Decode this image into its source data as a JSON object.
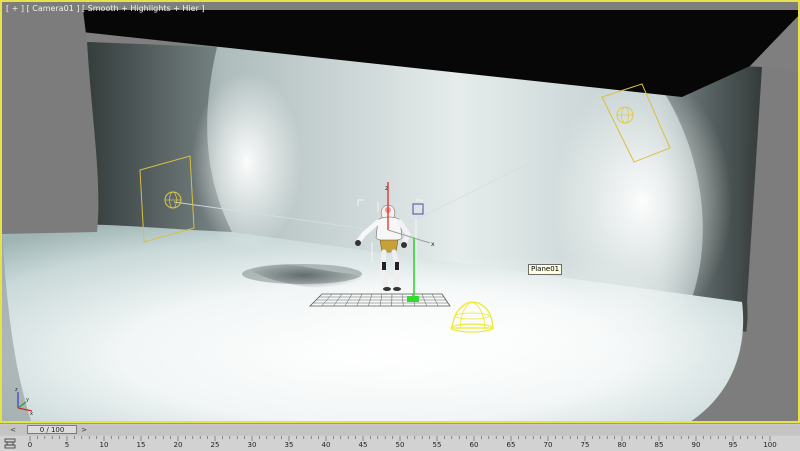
{
  "viewport": {
    "label": "[ + ] [ Camera01 ] [ Smooth + Highlights + Hier ]",
    "object_tag": "Plane01",
    "accent_color": "#e8e24a"
  },
  "time_slider": {
    "prev_icon": "<",
    "thumb_label": "0 / 100",
    "next_icon": ">"
  },
  "trackbar": {
    "icon": "trackbar-filter-icon",
    "ticks": [
      "0",
      "5",
      "10",
      "15",
      "20",
      "25",
      "30",
      "35",
      "40",
      "45",
      "50",
      "55",
      "60",
      "65",
      "70",
      "75",
      "80",
      "85",
      "90",
      "95",
      "100"
    ]
  }
}
